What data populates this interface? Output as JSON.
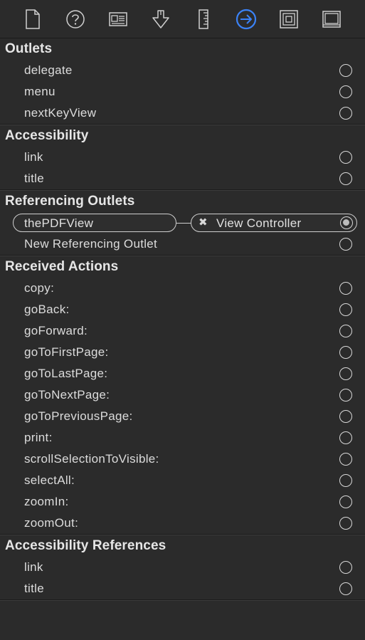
{
  "toolbar": {
    "icons": [
      {
        "name": "file-inspector-icon"
      },
      {
        "name": "help-inspector-icon"
      },
      {
        "name": "identity-inspector-icon"
      },
      {
        "name": "attributes-inspector-icon"
      },
      {
        "name": "size-inspector-icon"
      },
      {
        "name": "connections-inspector-icon",
        "selected": true
      },
      {
        "name": "bindings-inspector-icon"
      },
      {
        "name": "view-effects-inspector-icon"
      }
    ],
    "accent_color": "#3b82f6"
  },
  "sections": {
    "outlets": {
      "title": "Outlets",
      "items": [
        "delegate",
        "menu",
        "nextKeyView"
      ]
    },
    "accessibility": {
      "title": "Accessibility",
      "items": [
        "link",
        "title"
      ]
    },
    "referencing_outlets": {
      "title": "Referencing Outlets",
      "connection": {
        "outlet": "thePDFView",
        "target": "View Controller",
        "remove_glyph": "✖"
      },
      "new_outlet_label": "New Referencing Outlet"
    },
    "received_actions": {
      "title": "Received Actions",
      "items": [
        "copy:",
        "goBack:",
        "goForward:",
        "goToFirstPage:",
        "goToLastPage:",
        "goToNextPage:",
        "goToPreviousPage:",
        "print:",
        "scrollSelectionToVisible:",
        "selectAll:",
        "zoomIn:",
        "zoomOut:"
      ]
    },
    "accessibility_references": {
      "title": "Accessibility References",
      "items": [
        "link",
        "title"
      ]
    }
  }
}
